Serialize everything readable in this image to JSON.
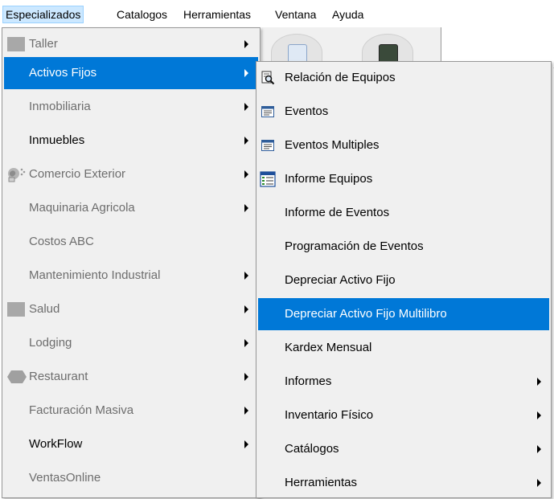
{
  "menubar": {
    "items": [
      "Especializados",
      "Catalogos",
      "Herramientas",
      "Ventana",
      "Ayuda"
    ]
  },
  "menu1": {
    "items": [
      {
        "label": "Taller",
        "icon": "module-icon",
        "submenu": true,
        "disabled": true
      },
      {
        "label": "Activos Fijos",
        "submenu": true,
        "disabled": false,
        "highlighted": true
      },
      {
        "label": "Inmobiliaria",
        "submenu": true,
        "disabled": true
      },
      {
        "label": "Inmuebles",
        "submenu": true,
        "disabled": false
      },
      {
        "label": "Comercio Exterior",
        "icon": "globe-icon",
        "submenu": true,
        "disabled": true
      },
      {
        "label": "Maquinaria Agricola",
        "submenu": true,
        "disabled": true
      },
      {
        "label": "Costos ABC",
        "submenu": false,
        "disabled": true
      },
      {
        "label": "Mantenimiento Industrial",
        "submenu": true,
        "disabled": true
      },
      {
        "label": "Salud",
        "icon": "module-icon",
        "submenu": true,
        "disabled": true
      },
      {
        "label": "Lodging",
        "submenu": true,
        "disabled": true
      },
      {
        "label": "Restaurant",
        "icon": "restaurant-icon",
        "submenu": true,
        "disabled": true
      },
      {
        "label": "Facturación Masiva",
        "submenu": true,
        "disabled": true
      },
      {
        "label": "WorkFlow",
        "submenu": true,
        "disabled": false
      },
      {
        "label": "VentasOnline",
        "submenu": false,
        "disabled": true
      }
    ]
  },
  "menu2": {
    "items": [
      {
        "label": "Relación de Equipos",
        "icon": "magnifier-document-icon",
        "submenu": false
      },
      {
        "label": "Eventos",
        "icon": "list-window-icon",
        "submenu": false
      },
      {
        "label": "Eventos Multiples",
        "icon": "list-window-icon",
        "submenu": false
      },
      {
        "label": "Informe Equipos",
        "icon": "report-table-icon",
        "submenu": false
      },
      {
        "label": "Informe de Eventos",
        "submenu": false
      },
      {
        "label": "Programación de Eventos",
        "submenu": false
      },
      {
        "label": "Depreciar Activo Fijo",
        "submenu": false
      },
      {
        "label": "Depreciar Activo Fijo Multilibro",
        "submenu": false,
        "highlighted": true
      },
      {
        "label": "Kardex Mensual",
        "submenu": false
      },
      {
        "label": "Informes",
        "submenu": true
      },
      {
        "label": "Inventario Físico",
        "submenu": true
      },
      {
        "label": "Catálogos",
        "submenu": true
      },
      {
        "label": "Herramientas",
        "submenu": true
      }
    ]
  },
  "colors": {
    "highlight": "#0078d7",
    "menubar_active": "#cce8ff",
    "menu_bg": "#f0f0f0",
    "disabled_text": "#6d6d6d"
  }
}
